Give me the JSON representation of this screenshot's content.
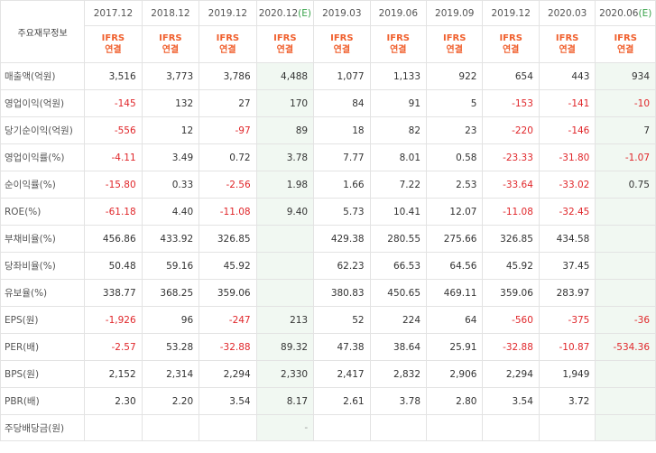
{
  "table": {
    "label_header": "주요재무정보",
    "periods": [
      {
        "label": "2017.12",
        "est": ""
      },
      {
        "label": "2018.12",
        "est": ""
      },
      {
        "label": "2019.12",
        "est": ""
      },
      {
        "label": "2020.12",
        "est": "(E)"
      },
      {
        "label": "2019.03",
        "est": ""
      },
      {
        "label": "2019.06",
        "est": ""
      },
      {
        "label": "2019.09",
        "est": ""
      },
      {
        "label": "2019.12",
        "est": ""
      },
      {
        "label": "2020.03",
        "est": ""
      },
      {
        "label": "2020.06",
        "est": "(E)"
      }
    ],
    "ifrs_line1": "IFRS",
    "ifrs_line2": "연결",
    "rows": [
      {
        "label": "매출액(억원)",
        "values": [
          "3,516",
          "3,773",
          "3,786",
          "4,488",
          "1,077",
          "1,133",
          "922",
          "654",
          "443",
          "934"
        ]
      },
      {
        "label": "영업이익(억원)",
        "values": [
          "-145",
          "132",
          "27",
          "170",
          "84",
          "91",
          "5",
          "-153",
          "-141",
          "-10"
        ]
      },
      {
        "label": "당기순이익(억원)",
        "values": [
          "-556",
          "12",
          "-97",
          "89",
          "18",
          "82",
          "23",
          "-220",
          "-146",
          "7"
        ]
      },
      {
        "label": "영업이익률(%)",
        "values": [
          "-4.11",
          "3.49",
          "0.72",
          "3.78",
          "7.77",
          "8.01",
          "0.58",
          "-23.33",
          "-31.80",
          "-1.07"
        ]
      },
      {
        "label": "순이익률(%)",
        "values": [
          "-15.80",
          "0.33",
          "-2.56",
          "1.98",
          "1.66",
          "7.22",
          "2.53",
          "-33.64",
          "-33.02",
          "0.75"
        ]
      },
      {
        "label": "ROE(%)",
        "values": [
          "-61.18",
          "4.40",
          "-11.08",
          "9.40",
          "5.73",
          "10.41",
          "12.07",
          "-11.08",
          "-32.45",
          ""
        ]
      },
      {
        "label": "부채비율(%)",
        "values": [
          "456.86",
          "433.92",
          "326.85",
          "",
          "429.38",
          "280.55",
          "275.66",
          "326.85",
          "434.58",
          ""
        ]
      },
      {
        "label": "당좌비율(%)",
        "values": [
          "50.48",
          "59.16",
          "45.92",
          "",
          "62.23",
          "66.53",
          "64.56",
          "45.92",
          "37.45",
          ""
        ]
      },
      {
        "label": "유보율(%)",
        "values": [
          "338.77",
          "368.25",
          "359.06",
          "",
          "380.83",
          "450.65",
          "469.11",
          "359.06",
          "283.97",
          ""
        ]
      },
      {
        "label": "EPS(원)",
        "values": [
          "-1,926",
          "96",
          "-247",
          "213",
          "52",
          "224",
          "64",
          "-560",
          "-375",
          "-36"
        ]
      },
      {
        "label": "PER(배)",
        "values": [
          "-2.57",
          "53.28",
          "-32.88",
          "89.32",
          "47.38",
          "38.64",
          "25.91",
          "-32.88",
          "-10.87",
          "-534.36"
        ]
      },
      {
        "label": "BPS(원)",
        "values": [
          "2,152",
          "2,314",
          "2,294",
          "2,330",
          "2,417",
          "2,832",
          "2,906",
          "2,294",
          "1,949",
          ""
        ]
      },
      {
        "label": "PBR(배)",
        "values": [
          "2.30",
          "2.20",
          "3.54",
          "8.17",
          "2.61",
          "3.78",
          "2.80",
          "3.54",
          "3.72",
          ""
        ]
      },
      {
        "label": "주당배당금(원)",
        "values": [
          "",
          "",
          "",
          "-",
          "",
          "",
          "",
          "",
          "",
          ""
        ]
      }
    ],
    "colors": {
      "negative": "#e0262a",
      "ifrs": "#f0602e",
      "estimate": "#3aa34b",
      "estimate_column_bg": "#f1f8f2",
      "grid": "#e3e3e3"
    }
  }
}
